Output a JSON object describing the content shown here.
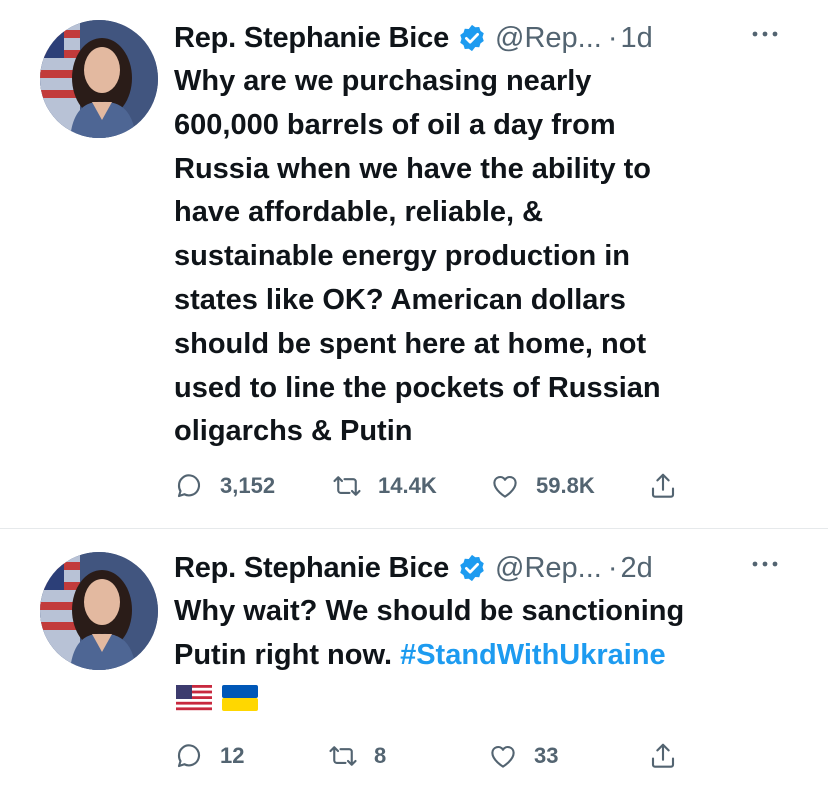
{
  "tweets": [
    {
      "author_name": "Rep. Stephanie Bice",
      "handle": "@Rep...",
      "separator": "·",
      "age": "1d",
      "text_lines": [
        "Why are we purchasing nearly",
        "600,000 barrels of oil a day from",
        "Russia when we have the ability to",
        "have affordable, reliable, &",
        "sustainable energy production in",
        "states like OK? American dollars",
        "should be spent here at home, not",
        "used to line the pockets of Russian",
        "oligarchs & Putin"
      ],
      "replies": "3,152",
      "retweets": "14.4K",
      "likes": "59.8K"
    },
    {
      "author_name": "Rep. Stephanie Bice",
      "handle": "@Rep...",
      "separator": "·",
      "age": "2d",
      "text_line_1": "Why wait? We should be sanctioning",
      "text_line_2": "Putin right now.",
      "hashtag": "#StandWithUkraine",
      "flags": [
        "us-flag-icon",
        "ukraine-flag-icon"
      ],
      "replies": "12",
      "retweets": "8",
      "likes": "33"
    }
  ],
  "colors": {
    "text": "#0f1419",
    "secondary": "#536471",
    "link": "#1d9bf0",
    "verified": "#1d9bf0"
  }
}
